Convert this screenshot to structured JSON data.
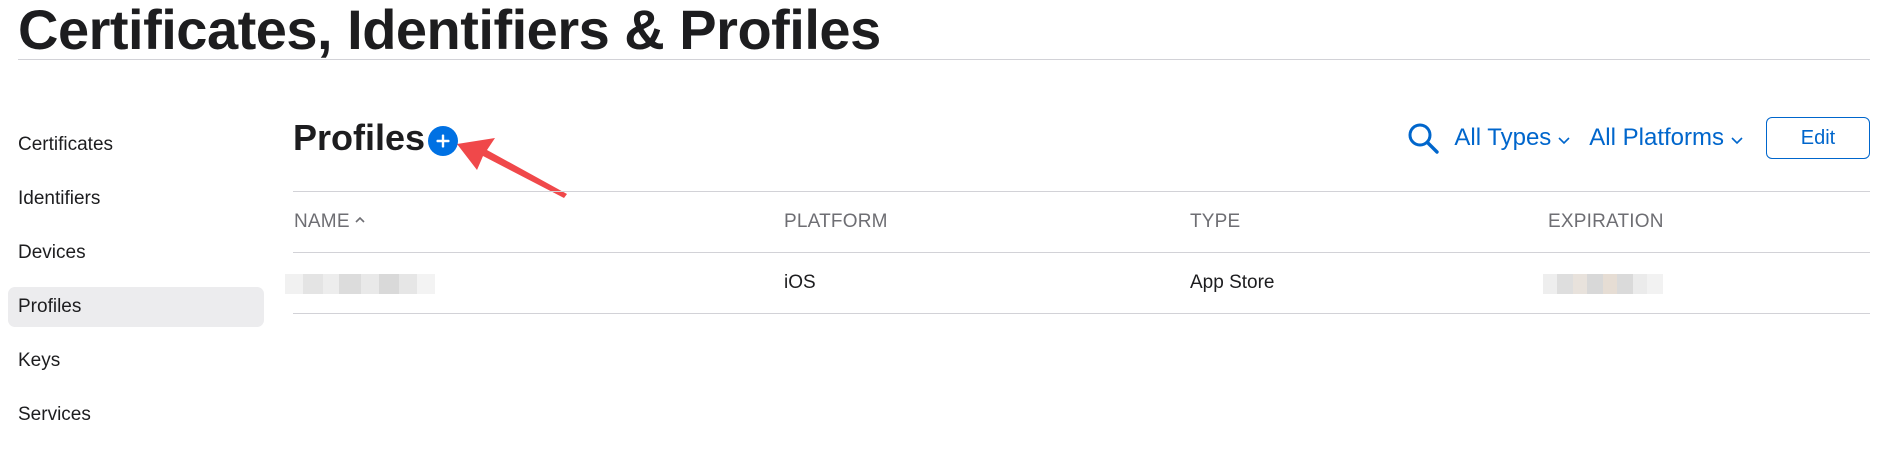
{
  "header": {
    "title": "Certificates, Identifiers & Profiles"
  },
  "sidebar": {
    "items": [
      {
        "label": "Certificates",
        "active": false
      },
      {
        "label": "Identifiers",
        "active": false
      },
      {
        "label": "Devices",
        "active": false
      },
      {
        "label": "Profiles",
        "active": true
      },
      {
        "label": "Keys",
        "active": false
      },
      {
        "label": "Services",
        "active": false
      }
    ]
  },
  "main": {
    "section_title": "Profiles",
    "add_icon": "plus-circle-icon",
    "toolbar": {
      "search_icon": "search-icon",
      "type_filter": "All Types",
      "platform_filter": "All Platforms",
      "edit_label": "Edit"
    },
    "table": {
      "headers": {
        "name": "NAME",
        "platform": "PLATFORM",
        "type": "TYPE",
        "expiration": "EXPIRATION"
      },
      "sort": {
        "column": "name",
        "direction": "ascending"
      },
      "rows": [
        {
          "name": "[redacted]",
          "platform": "iOS",
          "type": "App Store",
          "expiration": "[redacted]"
        }
      ]
    }
  },
  "colors": {
    "accent": "#0071e3",
    "link": "#0066cc",
    "annotation_arrow": "#f0484a",
    "sidebar_active_bg": "#ececee",
    "divider": "#d2d2d7"
  }
}
